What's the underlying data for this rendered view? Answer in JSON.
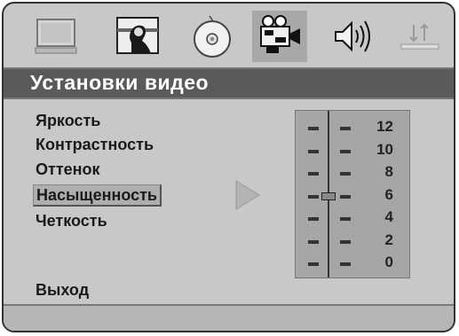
{
  "tabs": [
    {
      "name": "monitor-tab",
      "icon": "monitor-icon",
      "active": false
    },
    {
      "name": "language-tab",
      "icon": "person-portrait-icon",
      "active": false
    },
    {
      "name": "disc-tab",
      "icon": "disc-icon",
      "active": false
    },
    {
      "name": "video-tab",
      "icon": "video-camera-icon",
      "active": true
    },
    {
      "name": "audio-tab",
      "icon": "speaker-icon",
      "active": false
    },
    {
      "name": "setup-tab",
      "icon": "up-down-arrows-icon",
      "active": false
    }
  ],
  "header": {
    "title": "Установки видео"
  },
  "menu": {
    "items": [
      {
        "label": "Яркость",
        "selected": false
      },
      {
        "label": "Контрастность",
        "selected": false
      },
      {
        "label": "Оттенок",
        "selected": false
      },
      {
        "label": "Насыщенность",
        "selected": true
      },
      {
        "label": "Четкость",
        "selected": false
      }
    ],
    "exit_label": "Выход"
  },
  "scale": {
    "labels": [
      "12",
      "10",
      "8",
      "6",
      "4",
      "2",
      "0"
    ],
    "current_value": 6,
    "min": 0,
    "max": 12
  },
  "colors": {
    "frame_bg": "#c8c8c8",
    "title_bg": "#5a5a5a",
    "title_text": "#ffffff",
    "selected_bg": "#aeaeae",
    "scale_bg": "#a6a6a6"
  }
}
